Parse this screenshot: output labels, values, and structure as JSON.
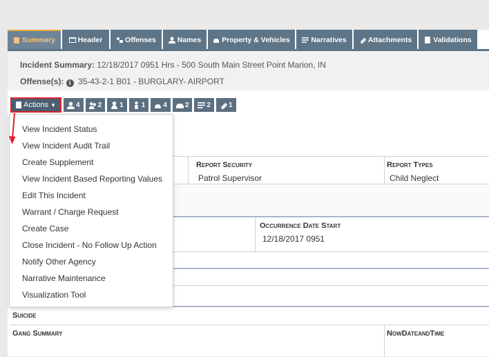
{
  "tabs": [
    {
      "label": "Summary",
      "icon": "clipboard-icon",
      "active": true
    },
    {
      "label": "Header",
      "icon": "window-icon",
      "active": false
    },
    {
      "label": "Offenses",
      "icon": "offenses-icon",
      "active": false
    },
    {
      "label": "Names",
      "icon": "user-icon",
      "active": false
    },
    {
      "label": "Property & Vehicles",
      "icon": "car-icon",
      "active": false
    },
    {
      "label": "Narratives",
      "icon": "lines-icon",
      "active": false
    },
    {
      "label": "Attachments",
      "icon": "paperclip-icon",
      "active": false
    },
    {
      "label": "Validations",
      "icon": "checklist-icon",
      "active": false
    }
  ],
  "summary": {
    "incident_label": "Incident Summary:",
    "incident_value": "12/18/2017 0951 Hrs - 500 South Main Street Point Marion, IN",
    "offense_label": "Offense(s):",
    "offense_value": "35-43-2-1 B01 - BURGLARY- AIRPORT"
  },
  "actions_button": "Actions",
  "counters": [
    {
      "icon": "user-icon",
      "count": "4"
    },
    {
      "icon": "users-icon",
      "count": "2"
    },
    {
      "icon": "person-icon",
      "count": "1"
    },
    {
      "icon": "officer-icon",
      "count": "1"
    },
    {
      "icon": "property-icon",
      "count": "4"
    },
    {
      "icon": "vehicle-icon",
      "count": "2"
    },
    {
      "icon": "list-icon",
      "count": "2"
    },
    {
      "icon": "attachment-icon",
      "count": "1"
    }
  ],
  "table": {
    "report_security_label": "Report Security",
    "report_security_value": "Patrol Supervisor",
    "report_types_label": "Report Types",
    "report_types_value": "Child Neglect",
    "occurrence_label": "Occurrence Date Start",
    "occurrence_value": "12/18/2017 0951",
    "suicide_label": "Suicide",
    "gang_label": "Gang Summary",
    "now_label": "NowDateandTime"
  },
  "dropdown_items": [
    "View Incident Status",
    "View Incident Audit Trail",
    "Create Supplement",
    "View Incident Based Reporting Values",
    "Edit This Incident",
    "Warrant / Charge Request",
    "Create Case",
    "Close Incident - No Follow Up Action",
    "Notify Other Agency",
    "Narrative Maintenance",
    "Visualization Tool"
  ],
  "colors": {
    "tab": "#5e7587",
    "active_tab_text": "#f5c27a",
    "highlight_border": "#e0202a",
    "arrow": "#e0202a"
  }
}
